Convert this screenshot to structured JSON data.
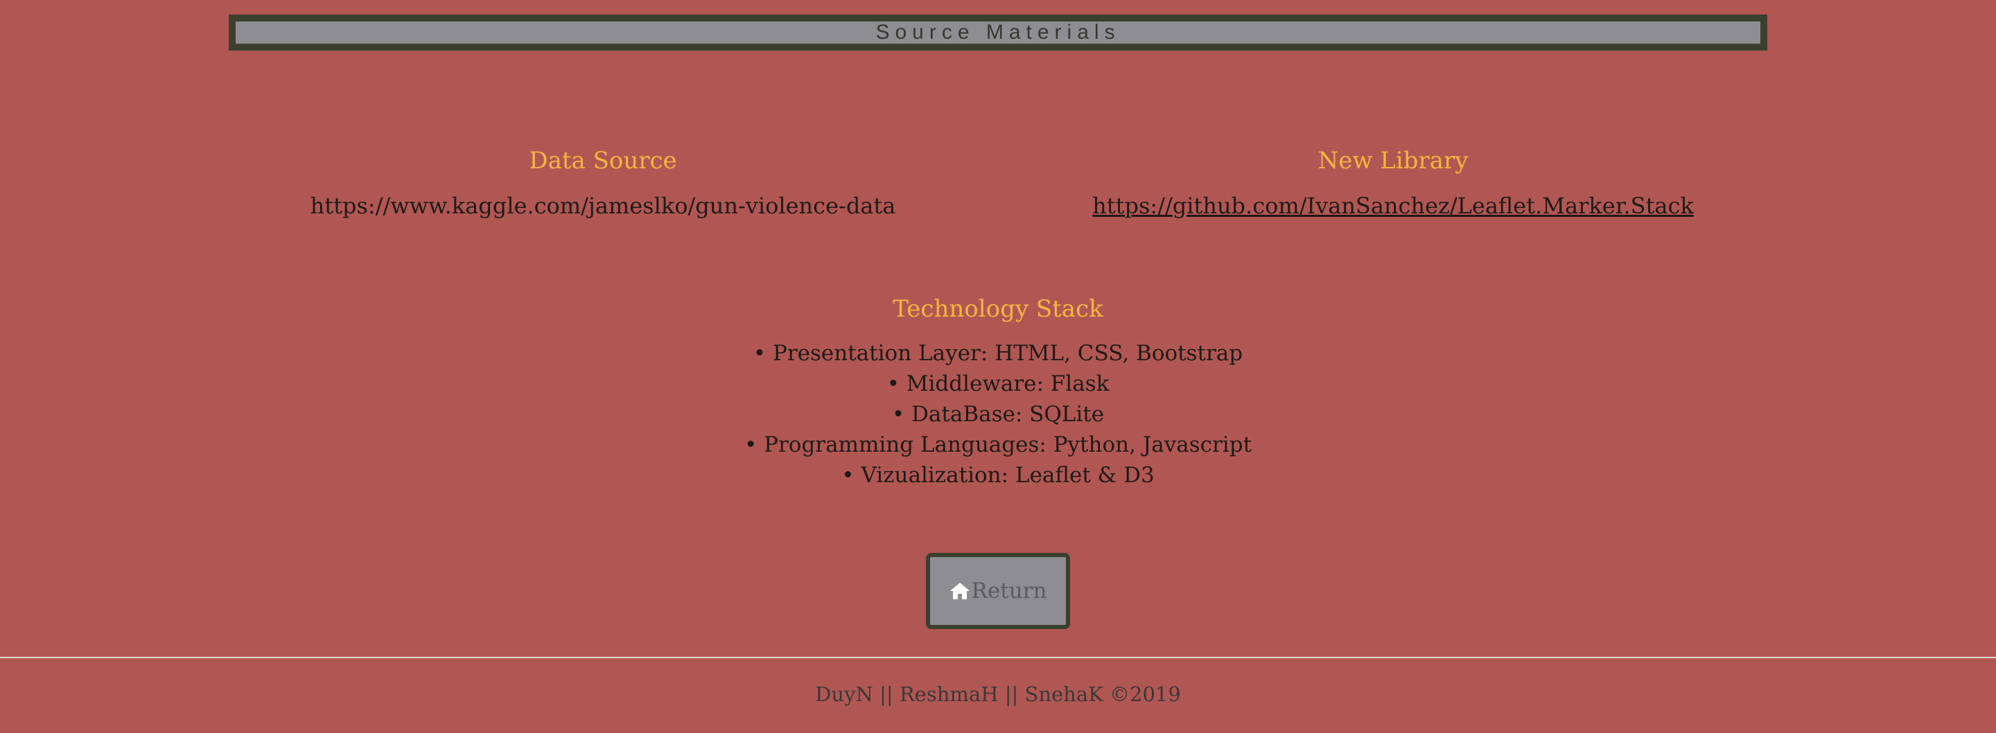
{
  "header": {
    "title": "Source Materials"
  },
  "data_source": {
    "heading": "Data Source",
    "text": "https://www.kaggle.com/jameslko/gun-violence-data"
  },
  "new_library": {
    "heading": "New Library",
    "link": "https://github.com/IvanSanchez/Leaflet.Marker.Stack"
  },
  "tech_stack": {
    "heading": "Technology Stack",
    "items": [
      "• Presentation Layer: HTML, CSS, Bootstrap",
      "• Middleware: Flask",
      "• DataBase: SQLite",
      "• Programming Languages: Python, Javascript",
      "• Vizualization: Leaflet & D3"
    ]
  },
  "return_button": {
    "label": "Return",
    "icon": "home-icon"
  },
  "footer": {
    "text": "DuyN || ReshmaH || SnehaK ©2019"
  },
  "colors": {
    "background": "#b15753",
    "heading": "#f4b641",
    "panel": "#8e8e92",
    "border": "#3b3f2e"
  }
}
